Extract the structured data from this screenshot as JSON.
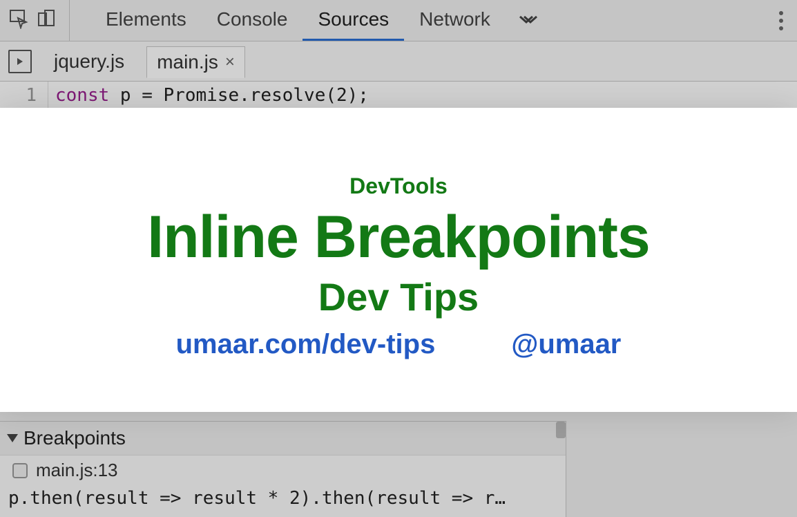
{
  "topbar": {
    "tabs": [
      {
        "label": "Elements",
        "active": false
      },
      {
        "label": "Console",
        "active": false
      },
      {
        "label": "Sources",
        "active": true
      },
      {
        "label": "Network",
        "active": false
      }
    ]
  },
  "fileTabs": [
    {
      "label": "jquery.js",
      "active": false
    },
    {
      "label": "main.js",
      "active": true
    }
  ],
  "code": {
    "lineNumber": "1",
    "keyword": "const",
    "rest": " p = Promise.resolve(2);"
  },
  "overlay": {
    "sub1": "DevTools",
    "title": "Inline Breakpoints",
    "sub2": "Dev Tips",
    "link1": "umaar.com/dev-tips",
    "link2": "@umaar"
  },
  "breakpoints": {
    "header": "Breakpoints",
    "item": "main.js:13",
    "code": "p.then(result => result * 2).then(result => r…"
  }
}
